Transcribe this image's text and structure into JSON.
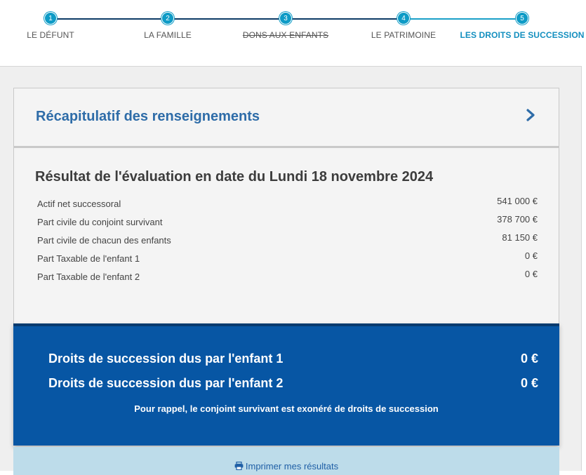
{
  "stepper": {
    "steps": [
      {
        "number": "1",
        "label": "LE DÉFUNT"
      },
      {
        "number": "2",
        "label": "LA FAMILLE"
      },
      {
        "number": "3",
        "label": "DONS AUX ENFANTS"
      },
      {
        "number": "4",
        "label": "LE PATRIMOINE"
      },
      {
        "number": "5",
        "label": "LES DROITS DE SUCCESSION"
      }
    ],
    "active_step": 5,
    "struck_step": 3
  },
  "recap": {
    "title": "Récapitulatif des renseignements",
    "icon": "chevron-right-icon"
  },
  "result": {
    "title": "Résultat de l'évaluation en date du Lundi 18 novembre 2024",
    "rows": [
      {
        "label": "Actif net successoral",
        "value": "541 000 €"
      },
      {
        "label": "Part civile du conjoint survivant",
        "value": "378 700 €"
      },
      {
        "label": "Part civile de chacun des enfants",
        "value": "81 150 €"
      },
      {
        "label": "Part Taxable de l'enfant 1",
        "value": "0 €"
      },
      {
        "label": "Part Taxable de l'enfant 2",
        "value": "0 €"
      }
    ]
  },
  "dues": {
    "rows": [
      {
        "label": "Droits de succession dus par l'enfant 1",
        "amount": "0 €"
      },
      {
        "label": "Droits de succession dus par l'enfant 2",
        "amount": "0 €"
      }
    ],
    "reminder": "Pour rappel, le conjoint survivant est exonéré de droits de succession"
  },
  "print": {
    "label": "Imprimer mes résultats",
    "icon": "printer-icon"
  },
  "colors": {
    "accent": "#0e9bc6",
    "dark_blue": "#0756a4",
    "link_blue": "#2e6ca8",
    "print_bg": "#bddcea"
  }
}
